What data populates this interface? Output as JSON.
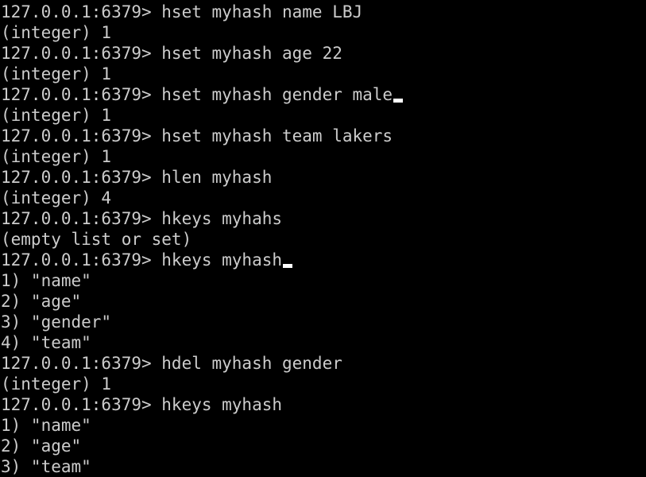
{
  "terminal": {
    "lines": [
      {
        "text": "127.0.0.1:6379> hset myhash name LBJ",
        "cursor": false
      },
      {
        "text": "(integer) 1",
        "cursor": false
      },
      {
        "text": "127.0.0.1:6379> hset myhash age 22",
        "cursor": false
      },
      {
        "text": "(integer) 1",
        "cursor": false
      },
      {
        "text": "127.0.0.1:6379> hset myhash gender male",
        "cursor": true
      },
      {
        "text": "(integer) 1",
        "cursor": false
      },
      {
        "text": "127.0.0.1:6379> hset myhash team lakers",
        "cursor": false
      },
      {
        "text": "(integer) 1",
        "cursor": false
      },
      {
        "text": "127.0.0.1:6379> hlen myhash",
        "cursor": false
      },
      {
        "text": "(integer) 4",
        "cursor": false
      },
      {
        "text": "127.0.0.1:6379> hkeys myhahs",
        "cursor": false
      },
      {
        "text": "(empty list or set)",
        "cursor": false
      },
      {
        "text": "127.0.0.1:6379> hkeys myhash",
        "cursor": true
      },
      {
        "text": "1) \"name\"",
        "cursor": false
      },
      {
        "text": "2) \"age\"",
        "cursor": false
      },
      {
        "text": "3) \"gender\"",
        "cursor": false
      },
      {
        "text": "4) \"team\"",
        "cursor": false
      },
      {
        "text": "127.0.0.1:6379> hdel myhash gender",
        "cursor": false
      },
      {
        "text": "(integer) 1",
        "cursor": false
      },
      {
        "text": "127.0.0.1:6379> hkeys myhash",
        "cursor": false
      },
      {
        "text": "1) \"name\"",
        "cursor": false
      },
      {
        "text": "2) \"age\"",
        "cursor": false
      },
      {
        "text": "3) \"team\"",
        "cursor": false
      }
    ]
  },
  "colors": {
    "background": "#000000",
    "text": "#cccccc",
    "cursor": "#ffffff"
  }
}
